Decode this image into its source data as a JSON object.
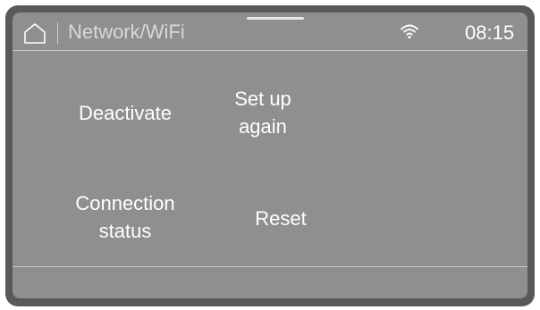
{
  "statusbar": {
    "home_icon": "home-icon",
    "title": "Network/WiFi",
    "wifi_icon": "wifi-icon",
    "time": "08:15"
  },
  "menu": {
    "deactivate": "Deactivate",
    "set_up_again": "Set up\nagain",
    "connection_status": "Connection\nstatus",
    "reset": "Reset"
  },
  "colors": {
    "bezel": "#595959",
    "screen": "#8f8f8f",
    "text": "#ffffff",
    "title_text": "#d8d8d8",
    "divider": "#c8c8c8"
  }
}
